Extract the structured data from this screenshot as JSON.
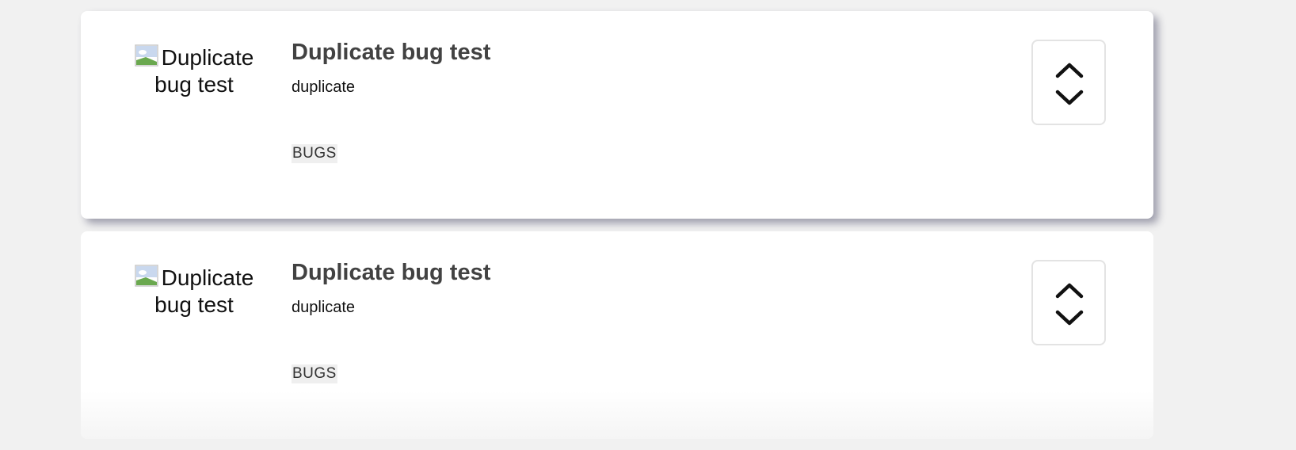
{
  "posts": [
    {
      "image_alt": "Duplicate bug test",
      "title": "Duplicate bug test",
      "description": "duplicate",
      "tag": "BUGS",
      "vote": {
        "up_icon": "chevron-up-icon",
        "down_icon": "chevron-down-icon"
      }
    },
    {
      "image_alt": "Duplicate bug test",
      "title": "Duplicate bug test",
      "description": "duplicate",
      "tag": "BUGS",
      "vote": {
        "up_icon": "chevron-up-icon",
        "down_icon": "chevron-down-icon"
      }
    }
  ]
}
